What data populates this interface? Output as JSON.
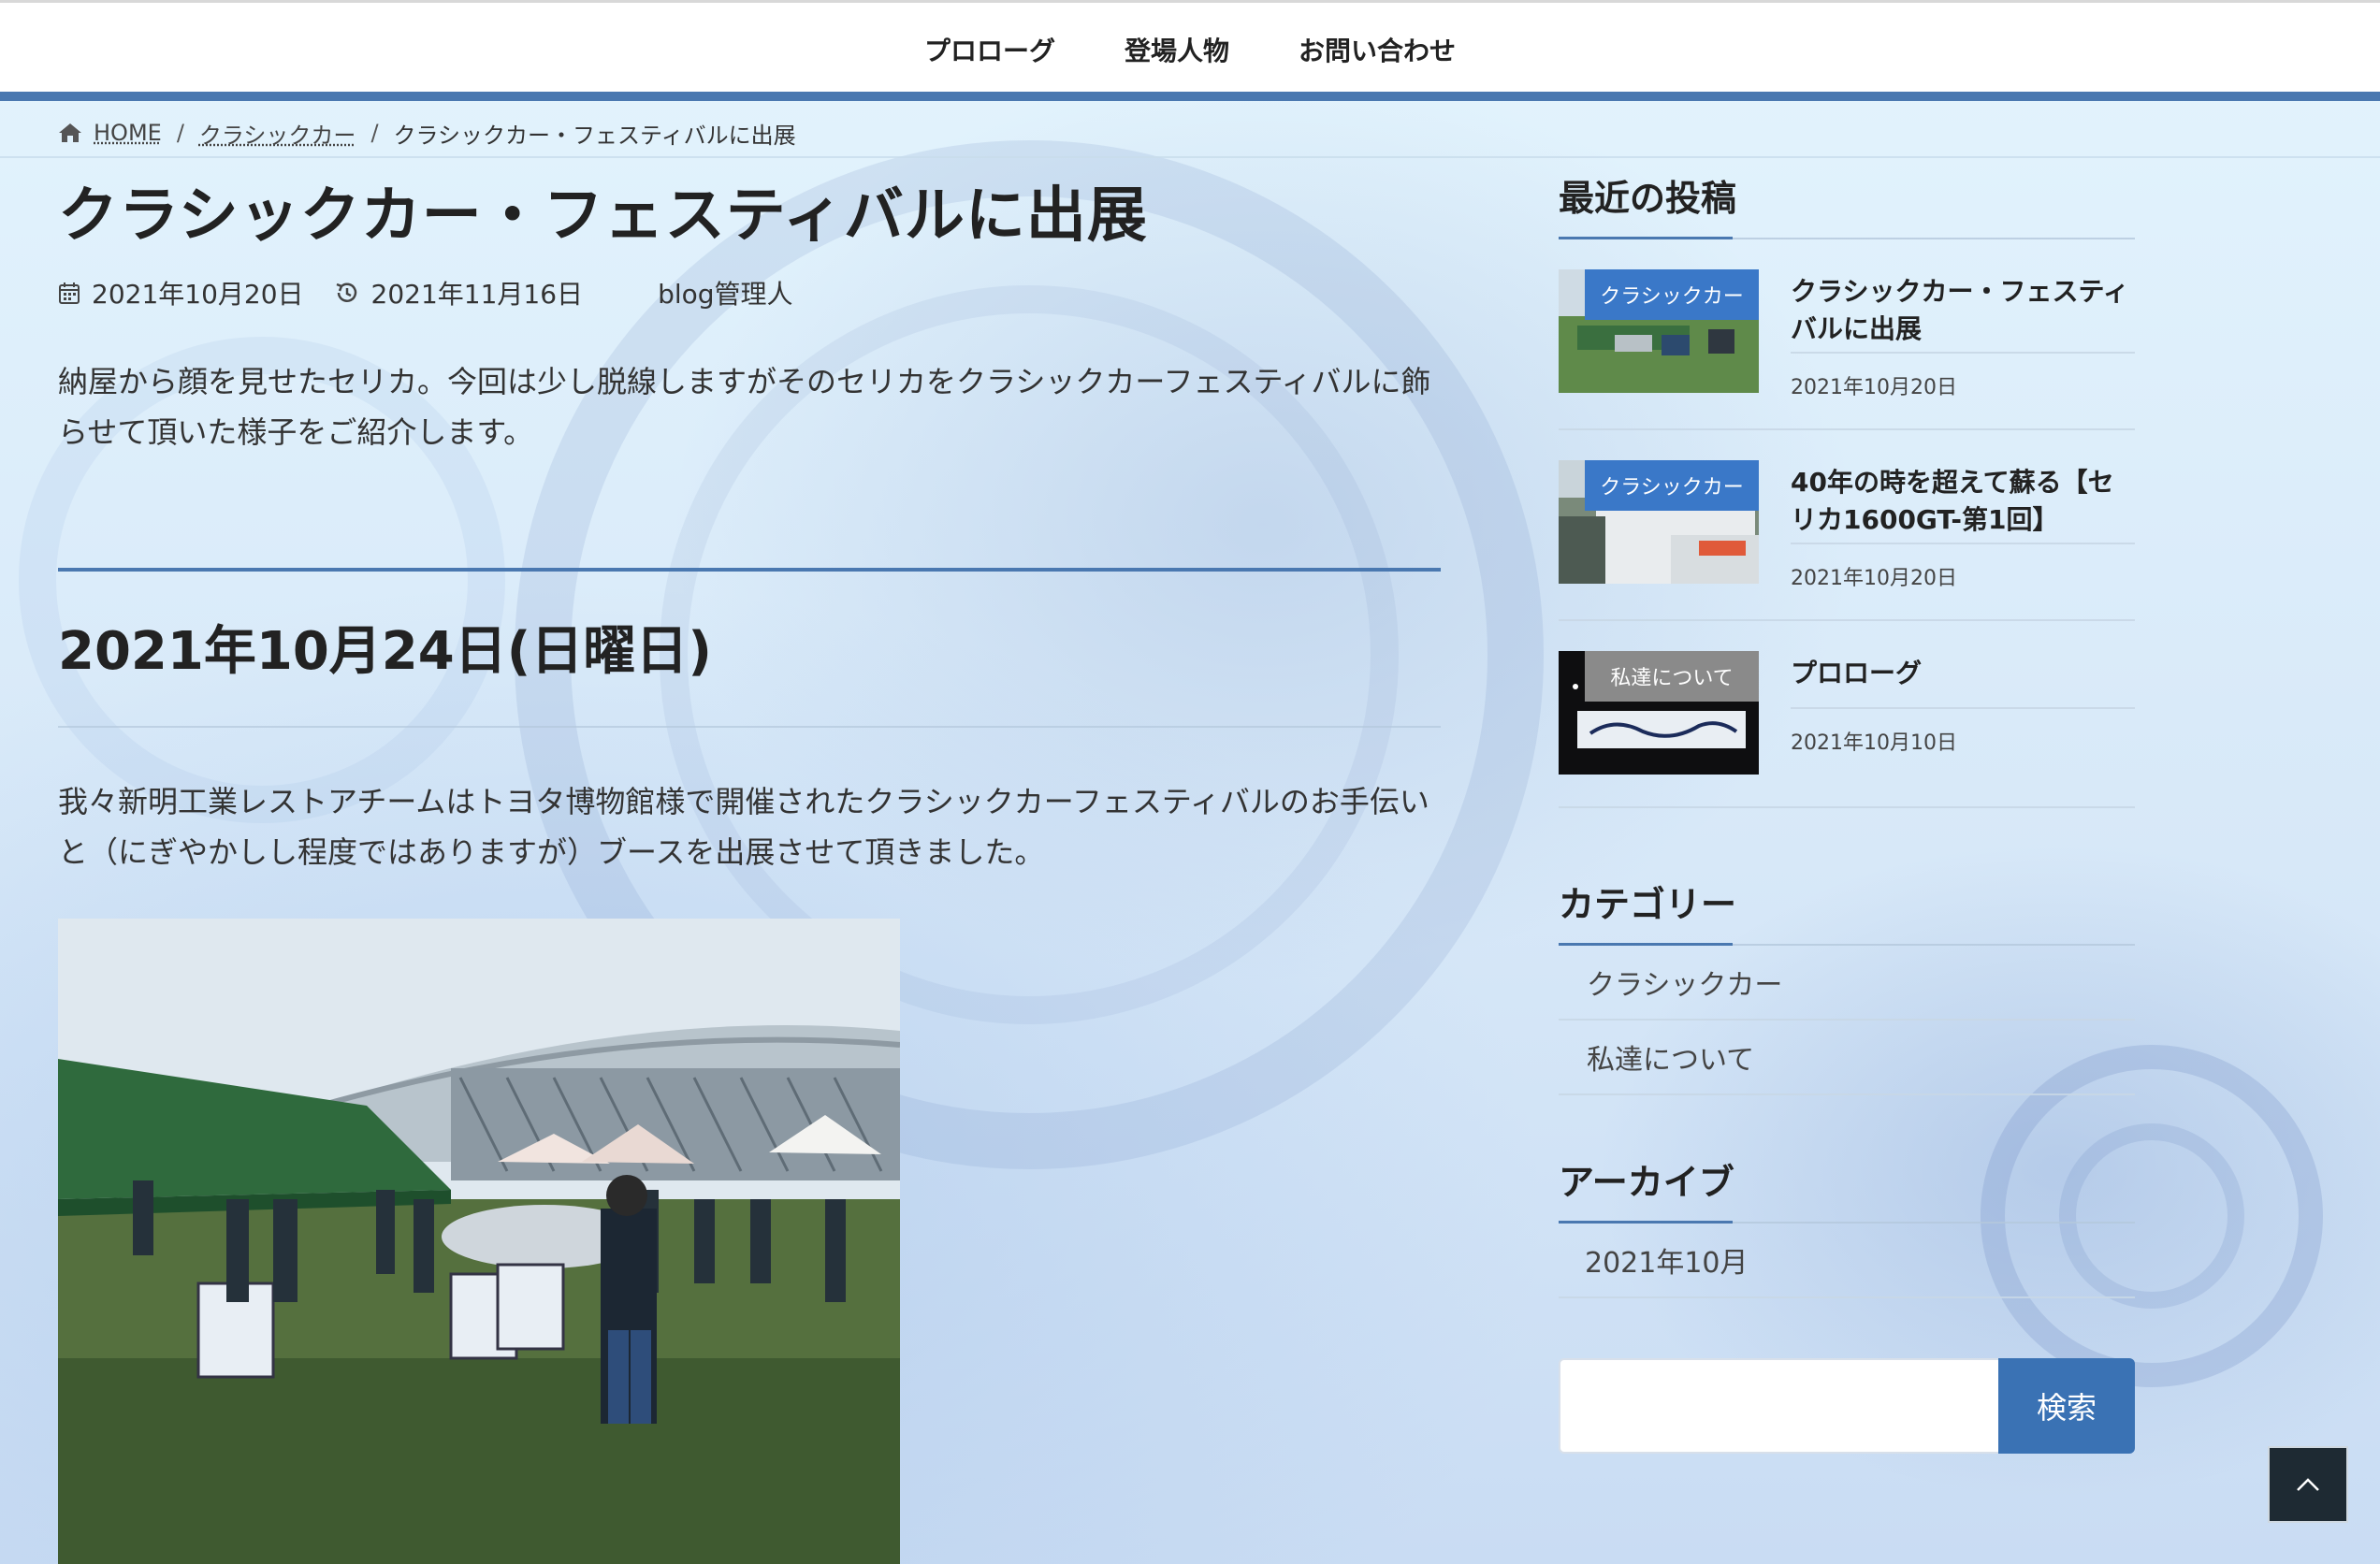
{
  "nav": {
    "items": [
      "プロローグ",
      "登場人物",
      "お問い合わせ"
    ]
  },
  "breadcrumb": {
    "home": "HOME",
    "category": "クラシックカー",
    "current": "クラシックカー・フェスティバルに出展",
    "separator": "/"
  },
  "article": {
    "title": "クラシックカー・フェスティバルに出展",
    "published": "2021年10月20日",
    "updated": "2021年11月16日",
    "author": "blog管理人",
    "intro": "納屋から顔を見せたセリカ。今回は少し脱線しますがそのセリカをクラシックカーフェスティバルに飾らせて頂いた様子をご紹介します。",
    "section_heading": "2021年10月24日(日曜日)",
    "body": "我々新明工業レストアチームはトヨタ博物館様で開催されたクラシックカーフェスティバルのお手伝いと（にぎやかしし程度ではありますが）ブースを出展させて頂きました。"
  },
  "sidebar": {
    "recent_title": "最近の投稿",
    "recent_posts": [
      {
        "badge": "クラシックカー",
        "title": "クラシックカー・フェスティバルに出展",
        "date": "2021年10月20日"
      },
      {
        "badge": "クラシックカー",
        "title": "40年の時を超えて蘇る【セリカ1600GT-第1回】",
        "date": "2021年10月20日"
      },
      {
        "badge": "私達について",
        "title": "プロローグ",
        "date": "2021年10月10日"
      }
    ],
    "category_title": "カテゴリー",
    "categories": [
      "クラシックカー",
      "私達について"
    ],
    "archive_title": "アーカイブ",
    "archives": [
      "2021年10月"
    ],
    "search_placeholder": "",
    "search_button": "検索"
  },
  "colors": {
    "accent": "#4a78b0",
    "badge_blue": "#3a78c8",
    "badge_gray": "#8a8a8a",
    "search_button": "#3a72b4"
  },
  "icons": {
    "home": "home-icon",
    "calendar": "calendar-icon",
    "updated": "history-icon",
    "to_top": "chevron-up-icon"
  }
}
